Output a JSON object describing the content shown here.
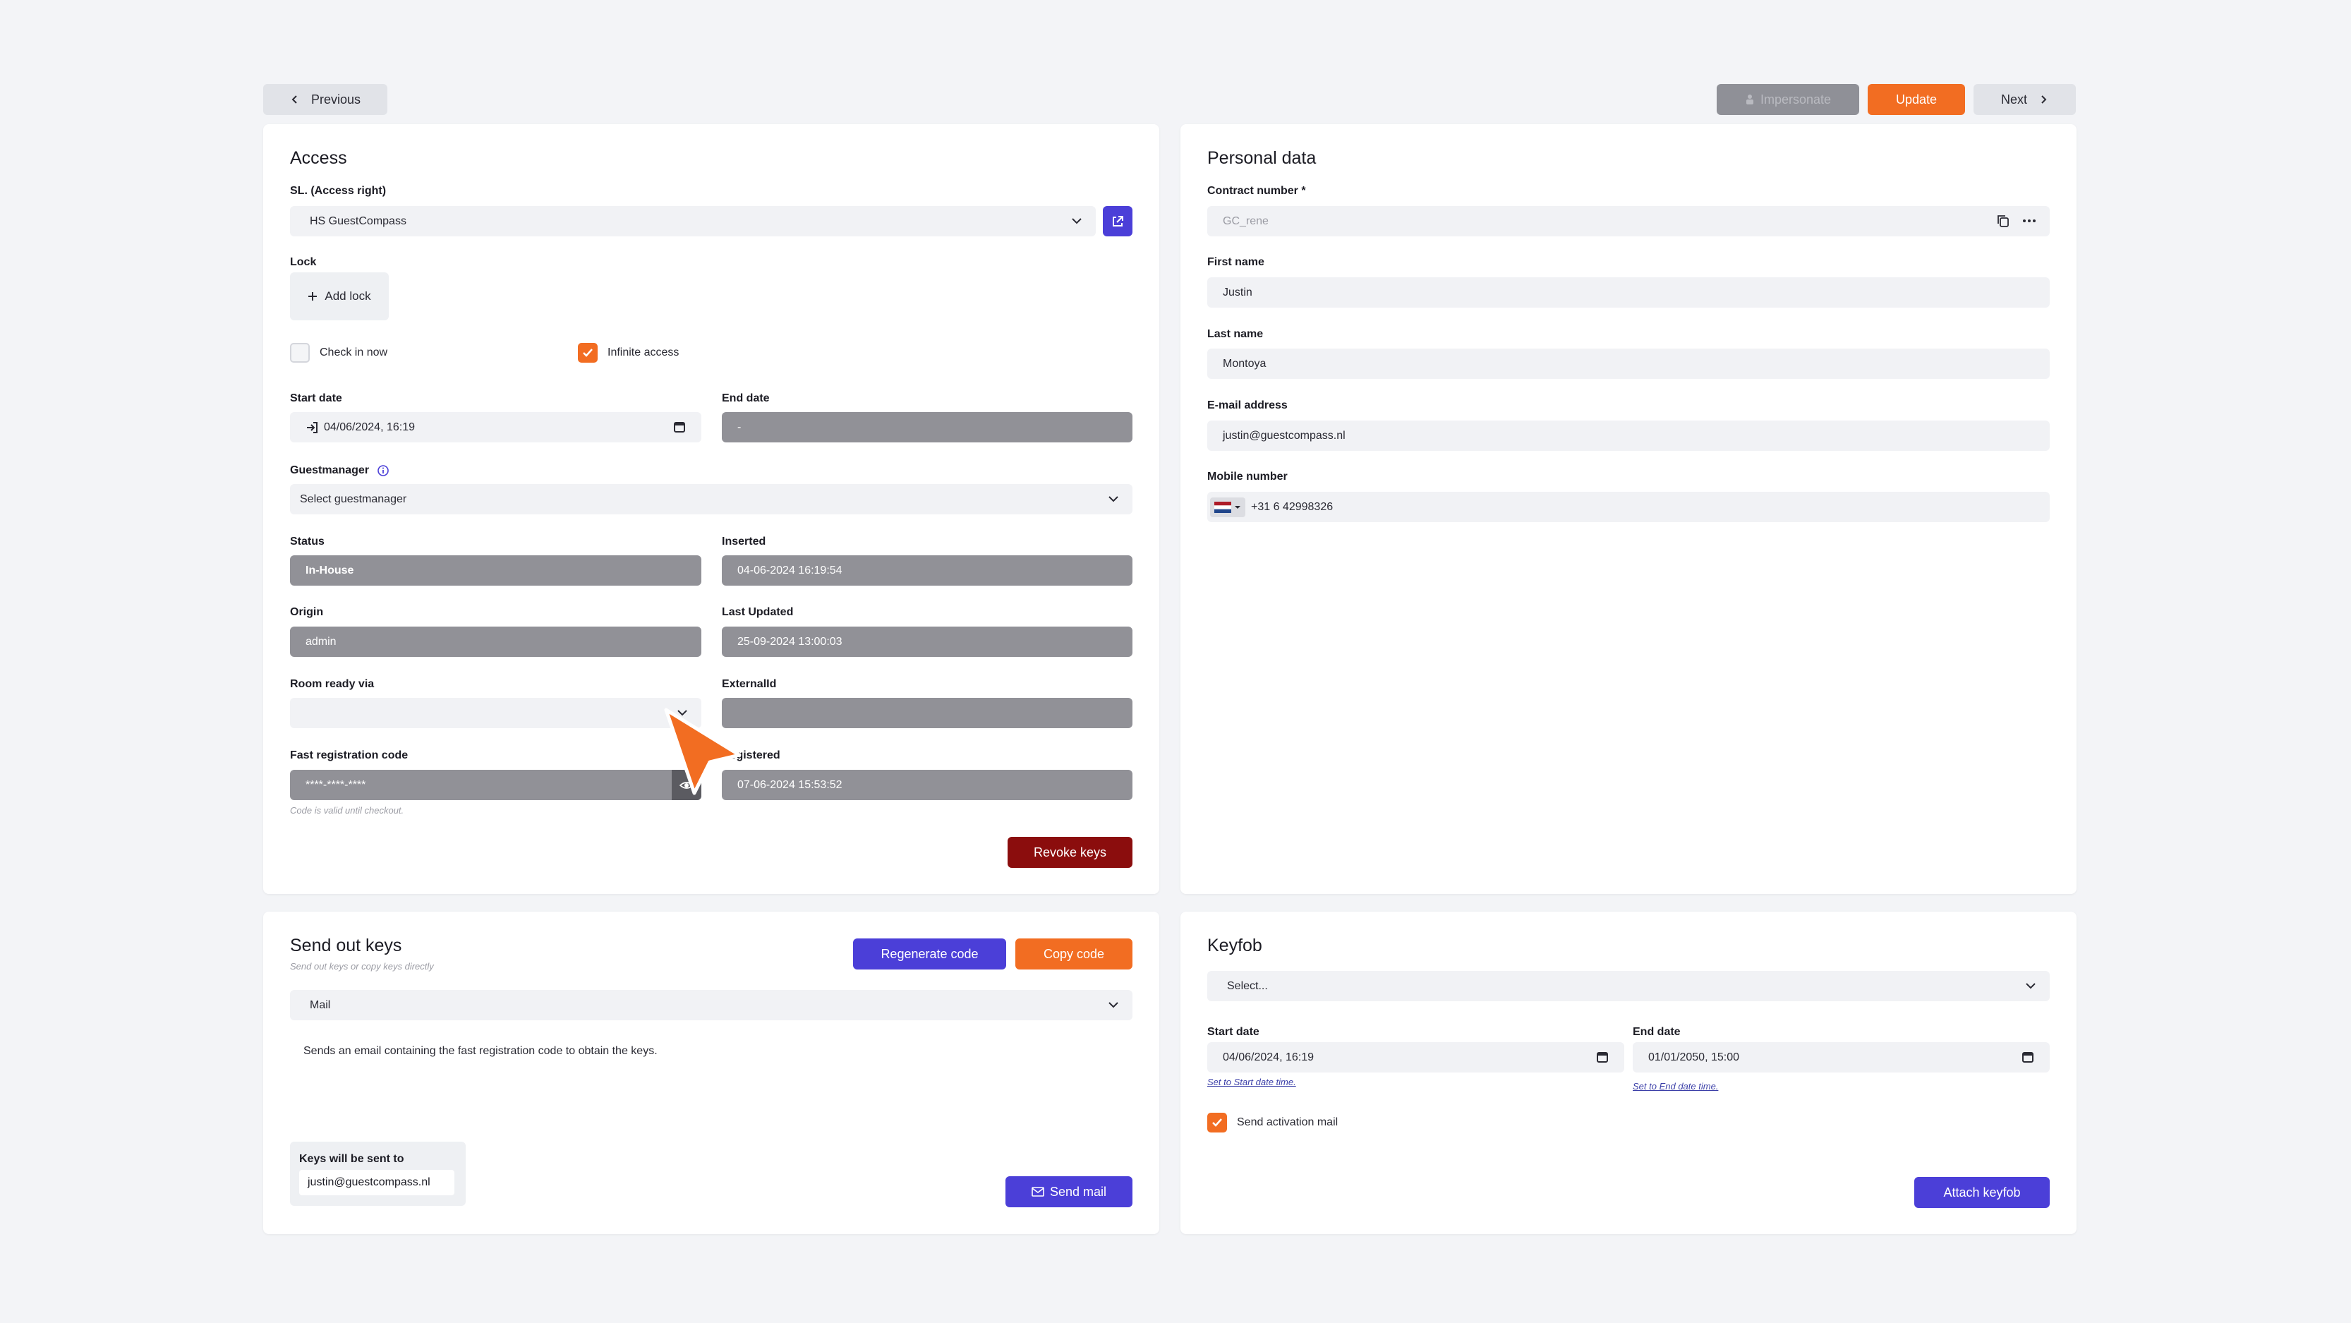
{
  "topbar": {
    "previous_label": "Previous",
    "impersonate_label": "Impersonate",
    "update_label": "Update",
    "next_label": "Next"
  },
  "colors": {
    "accent_orange": "#f26d22",
    "accent_purple": "#4b3fd8",
    "danger": "#8b0d0d",
    "readonly_field": "#919197"
  },
  "access": {
    "title": "Access",
    "sl_label": "SL. (Access right)",
    "sl_value": "HS GuestCompass",
    "lock_label": "Lock",
    "add_lock_label": "Add lock",
    "check_in_now_label": "Check in now",
    "check_in_now_checked": false,
    "infinite_access_label": "Infinite access",
    "infinite_access_checked": true,
    "start_date_label": "Start date",
    "start_date_value": "04/06/2024, 16:19",
    "end_date_label": "End date",
    "end_date_value": "-",
    "guestmanager_label": "Guestmanager",
    "guestmanager_placeholder": "Select guestmanager",
    "status_label": "Status",
    "status_value": "In-House",
    "inserted_label": "Inserted",
    "inserted_value": "04-06-2024 16:19:54",
    "origin_label": "Origin",
    "origin_value": "admin",
    "last_updated_label": "Last Updated",
    "last_updated_value": "25-09-2024 13:00:03",
    "room_ready_label": "Room ready via",
    "room_ready_value": "",
    "externalid_label": "ExternalId",
    "externalid_value": "",
    "fast_reg_label": "Fast registration code",
    "fast_reg_value": "****-****-****",
    "fast_reg_hint": "Code is valid until checkout.",
    "registered_label": "Registered",
    "registered_value": "07-06-2024 15:53:52",
    "revoke_label": "Revoke keys"
  },
  "personal": {
    "title": "Personal data",
    "contract_label": "Contract number *",
    "contract_value": "GC_rene",
    "first_name_label": "First name",
    "first_name_value": "Justin",
    "last_name_label": "Last name",
    "last_name_value": "Montoya",
    "email_label": "E-mail address",
    "email_value": "justin@guestcompass.nl",
    "mobile_label": "Mobile number",
    "mobile_value": "+31 6 42998326"
  },
  "sendkeys": {
    "title": "Send out keys",
    "subtitle": "Send out keys or copy keys directly",
    "regenerate_label": "Regenerate code",
    "copy_label": "Copy code",
    "method_value": "Mail",
    "description": "Sends an email containing the fast registration code to obtain the keys.",
    "recipient_label": "Keys will be sent to",
    "recipient_value": "justin@guestcompass.nl",
    "send_label": "Send mail"
  },
  "keyfob": {
    "title": "Keyfob",
    "select_placeholder": "Select...",
    "start_date_label": "Start date",
    "start_date_value": "04/06/2024, 16:19",
    "start_link": "Set to Start date time.",
    "end_date_label": "End date",
    "end_date_value": "01/01/2050, 15:00",
    "end_link": "Set to End date time.",
    "activation_label": "Send activation mail",
    "activation_checked": true,
    "attach_label": "Attach keyfob"
  }
}
